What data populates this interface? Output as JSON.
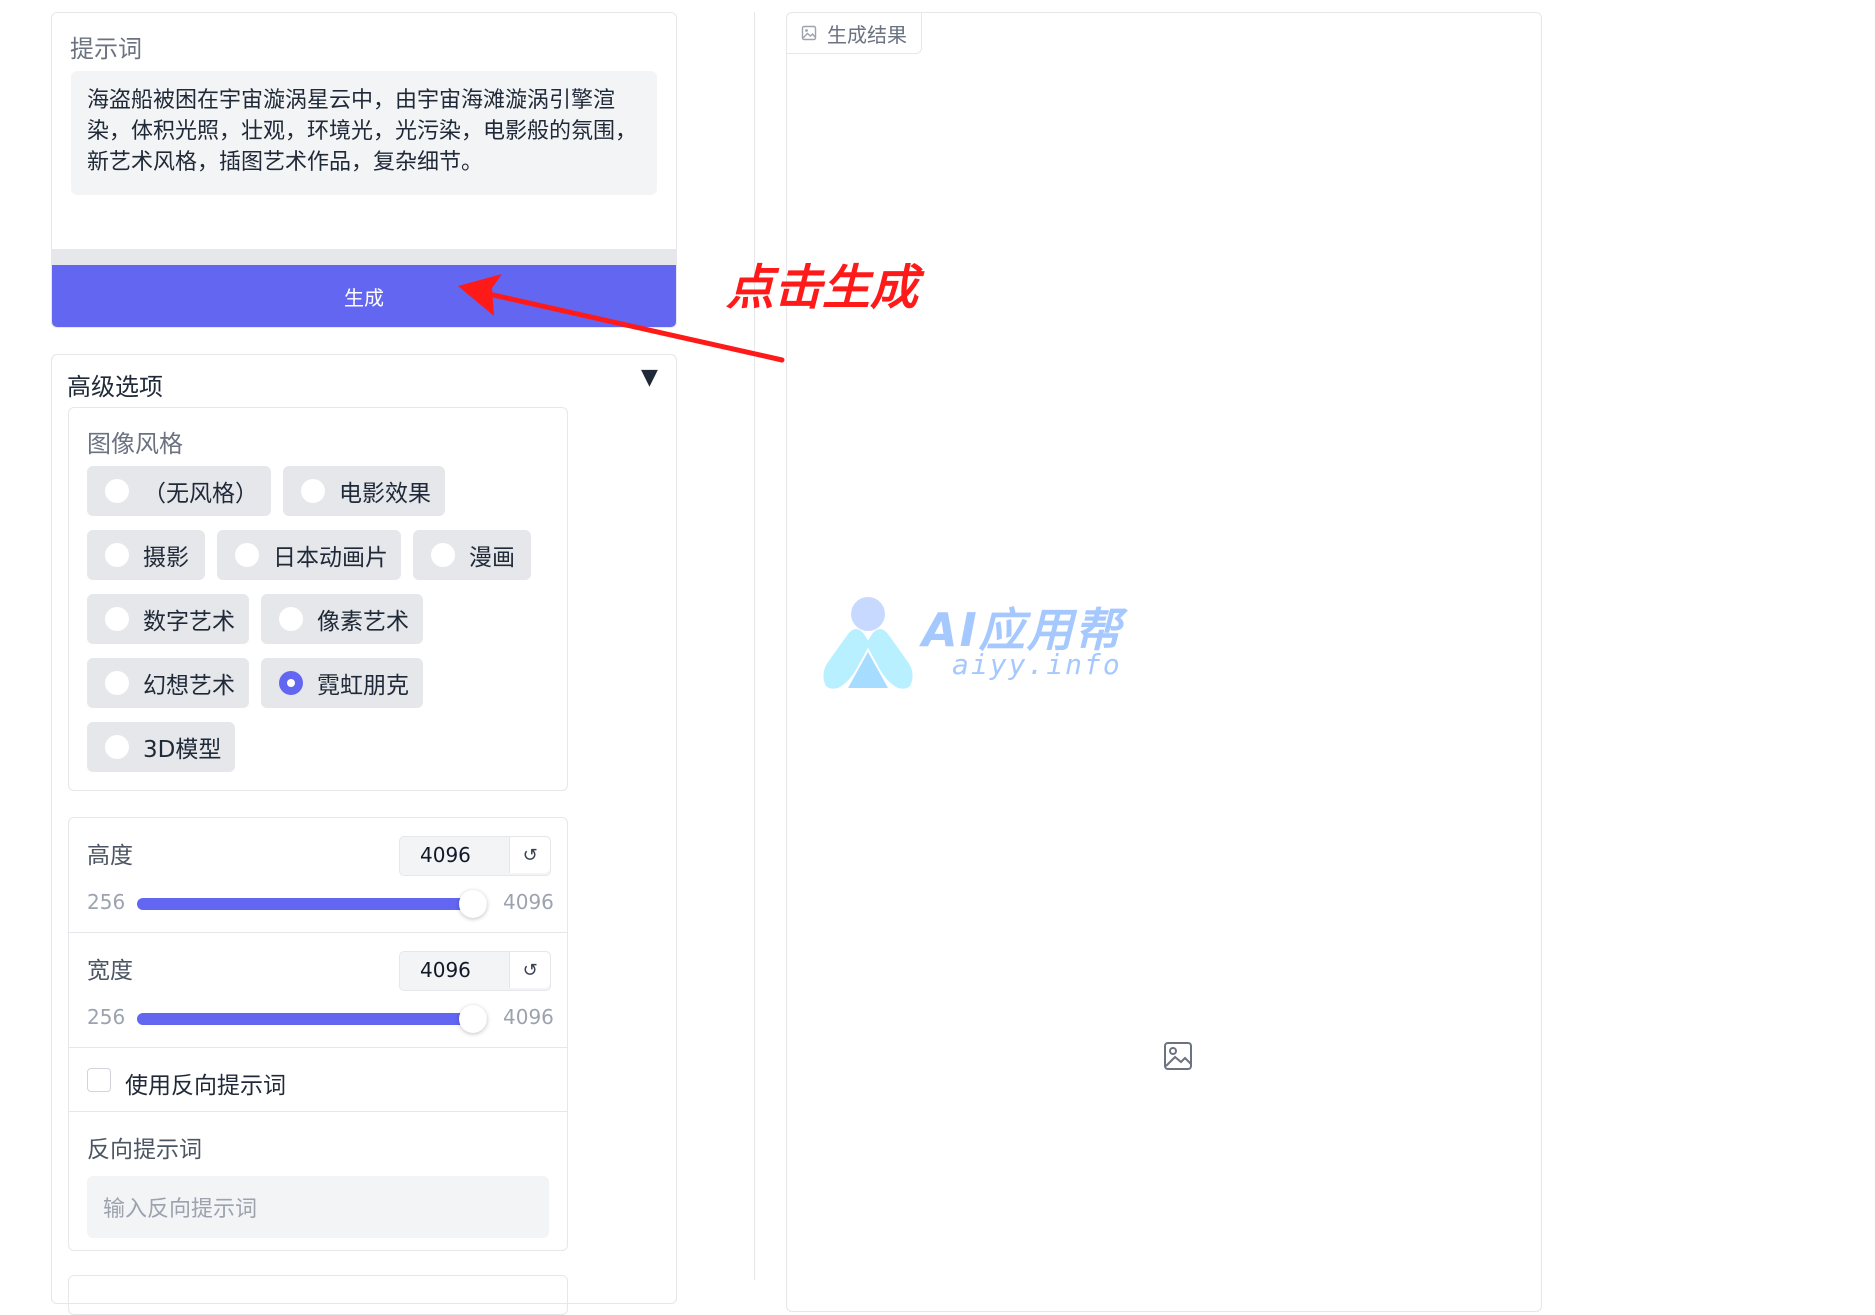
{
  "prompt": {
    "label": "提示词",
    "value": "海盗船被困在宇宙漩涡星云中，由宇宙海滩漩涡引擎渲染，体积光照，壮观，环境光，光污染，电影般的氛围，新艺术风格，插图艺术作品，复杂细节。",
    "generate_label": "生成"
  },
  "advanced": {
    "title": "高级选项",
    "toggle_icon": "▼",
    "style": {
      "label": "图像风格",
      "options": [
        "（无风格）",
        "电影效果",
        "摄影",
        "日本动画片",
        "漫画",
        "数字艺术",
        "像素艺术",
        "幻想艺术",
        "霓虹朋克",
        "3D模型"
      ],
      "selected": "霓虹朋克"
    },
    "height": {
      "label": "高度",
      "value": "4096",
      "min": "256",
      "max": "4096",
      "reset_icon": "↺"
    },
    "width": {
      "label": "宽度",
      "value": "4096",
      "min": "256",
      "max": "4096",
      "reset_icon": "↺"
    },
    "negative": {
      "checkbox_label": "使用反向提示词",
      "checked": false,
      "label": "反向提示词",
      "placeholder": "输入反向提示词"
    }
  },
  "result": {
    "tab_label": "生成结果",
    "tab_icon": "image-icon",
    "placeholder_icon": "image-icon"
  },
  "watermark": {
    "brand": "AI应用帮",
    "domain": "aiyy.info"
  },
  "annotation": {
    "text": "点击生成",
    "color": "#ff1a1a"
  },
  "colors": {
    "accent": "#6366f1",
    "panel_bg": "#f3f4f6",
    "border": "#e5e7eb"
  }
}
